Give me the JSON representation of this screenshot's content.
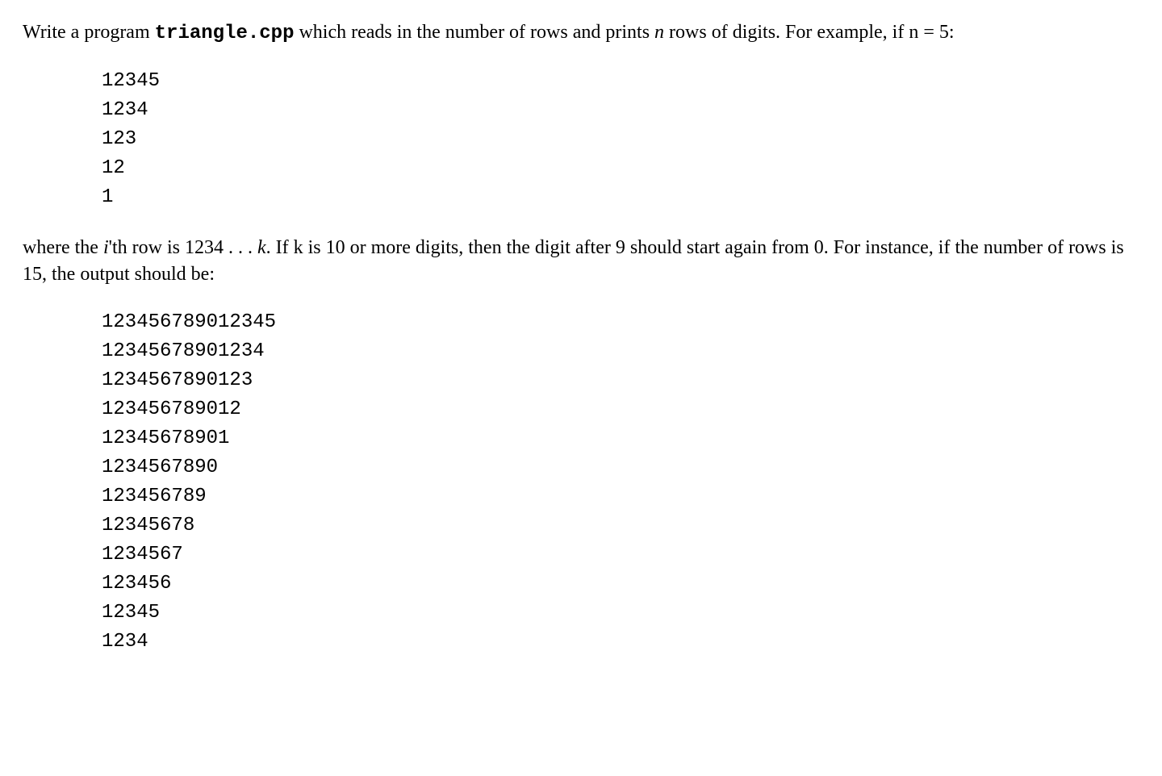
{
  "paragraph1": {
    "part1": "Write a program ",
    "code": "triangle.cpp",
    "part2": " which reads in the number of rows and prints ",
    "italic1": "n",
    "part3": " rows of digits. For example, if n = 5:"
  },
  "code_block1": "12345\n1234\n123\n12\n1",
  "paragraph2": {
    "part1": "where the ",
    "italic1": "i",
    "part2": "'th row is 1234 . . . ",
    "italic2": "k",
    "part3": ". If k is 10 or more digits, then the digit after 9 should start again from 0. For instance, if the number of rows is 15, the output should be:"
  },
  "code_block2": "123456789012345\n12345678901234\n1234567890123\n123456789012\n12345678901\n1234567890\n123456789\n12345678\n1234567\n123456\n12345\n1234"
}
